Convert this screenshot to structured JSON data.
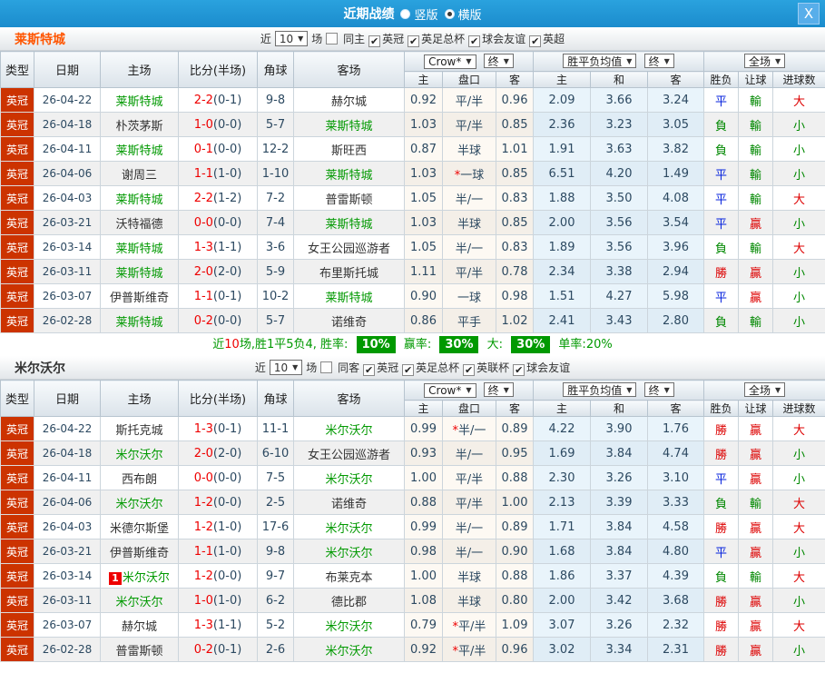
{
  "titlebar": {
    "title": "近期战绩",
    "vertical_label": "竖版",
    "horizontal_label": "横版",
    "selected_layout": "横版",
    "close_glyph": "X"
  },
  "colors": {
    "win": "#dd0000",
    "draw": "#0522dd",
    "lose": "#008800",
    "accent": "#cc3300",
    "bar": "#1e96d8",
    "badge": "#009900"
  },
  "columns": {
    "type": "类型",
    "date": "日期",
    "home": "主场",
    "score": "比分(半场)",
    "corner": "角球",
    "away": "客场",
    "sub": [
      "主",
      "盘口",
      "客",
      "主",
      "和",
      "客",
      "胜负",
      "让球",
      "进球数"
    ]
  },
  "dropdowns": {
    "crow": "Crow*",
    "final1": "终",
    "avg": "胜平负均值",
    "final2": "终",
    "full": "全场"
  },
  "sections": [
    {
      "team": "莱斯特城",
      "filter": {
        "near": "近",
        "count": "10",
        "games": "场",
        "same_label": "同主",
        "same_checked": false,
        "leagues": [
          {
            "label": "英冠",
            "checked": true
          },
          {
            "label": "英足总杯",
            "checked": true
          },
          {
            "label": "球会友谊",
            "checked": true
          },
          {
            "label": "英超",
            "checked": true
          }
        ]
      },
      "rows": [
        {
          "league": "英冠",
          "date": "26-04-22",
          "home": "莱斯特城",
          "home_self": true,
          "home_badge": "",
          "score": "2-2",
          "half": "(0-1)",
          "corners": "9-8",
          "away": "赫尔城",
          "away_self": false,
          "odds_home": "0.92",
          "handicap": "平/半",
          "handicap_star": false,
          "odds_away": "0.96",
          "avg_win": "2.09",
          "avg_draw": "3.66",
          "avg_lose": "3.24",
          "result_wdl": "平",
          "result_wdl_color": "draw",
          "result_handicap": "輸",
          "result_handicap_color": "lose",
          "result_goals": "大",
          "result_goals_color": "win"
        },
        {
          "league": "英冠",
          "date": "26-04-18",
          "home": "朴茨茅斯",
          "home_self": false,
          "home_badge": "",
          "score": "1-0",
          "half": "(0-0)",
          "corners": "5-7",
          "away": "莱斯特城",
          "away_self": true,
          "odds_home": "1.03",
          "handicap": "平/半",
          "handicap_star": false,
          "odds_away": "0.85",
          "avg_win": "2.36",
          "avg_draw": "3.23",
          "avg_lose": "3.05",
          "result_wdl": "負",
          "result_wdl_color": "lose",
          "result_handicap": "輸",
          "result_handicap_color": "lose",
          "result_goals": "小",
          "result_goals_color": "lose"
        },
        {
          "league": "英冠",
          "date": "26-04-11",
          "home": "莱斯特城",
          "home_self": true,
          "home_badge": "",
          "score": "0-1",
          "half": "(0-0)",
          "corners": "12-2",
          "away": "斯旺西",
          "away_self": false,
          "odds_home": "0.87",
          "handicap": "半球",
          "handicap_star": false,
          "odds_away": "1.01",
          "avg_win": "1.91",
          "avg_draw": "3.63",
          "avg_lose": "3.82",
          "result_wdl": "負",
          "result_wdl_color": "lose",
          "result_handicap": "輸",
          "result_handicap_color": "lose",
          "result_goals": "小",
          "result_goals_color": "lose"
        },
        {
          "league": "英冠",
          "date": "26-04-06",
          "home": "谢周三",
          "home_self": false,
          "home_badge": "",
          "score": "1-1",
          "half": "(1-0)",
          "corners": "1-10",
          "away": "莱斯特城",
          "away_self": true,
          "odds_home": "1.03",
          "handicap": "一球",
          "handicap_star": true,
          "odds_away": "0.85",
          "avg_win": "6.51",
          "avg_draw": "4.20",
          "avg_lose": "1.49",
          "result_wdl": "平",
          "result_wdl_color": "draw",
          "result_handicap": "輸",
          "result_handicap_color": "lose",
          "result_goals": "小",
          "result_goals_color": "lose"
        },
        {
          "league": "英冠",
          "date": "26-04-03",
          "home": "莱斯特城",
          "home_self": true,
          "home_badge": "",
          "score": "2-2",
          "half": "(1-2)",
          "corners": "7-2",
          "away": "普雷斯顿",
          "away_self": false,
          "odds_home": "1.05",
          "handicap": "半/一",
          "handicap_star": false,
          "odds_away": "0.83",
          "avg_win": "1.88",
          "avg_draw": "3.50",
          "avg_lose": "4.08",
          "result_wdl": "平",
          "result_wdl_color": "draw",
          "result_handicap": "輸",
          "result_handicap_color": "lose",
          "result_goals": "大",
          "result_goals_color": "win"
        },
        {
          "league": "英冠",
          "date": "26-03-21",
          "home": "沃特福德",
          "home_self": false,
          "home_badge": "",
          "score": "0-0",
          "half": "(0-0)",
          "corners": "7-4",
          "away": "莱斯特城",
          "away_self": true,
          "odds_home": "1.03",
          "handicap": "半球",
          "handicap_star": false,
          "odds_away": "0.85",
          "avg_win": "2.00",
          "avg_draw": "3.56",
          "avg_lose": "3.54",
          "result_wdl": "平",
          "result_wdl_color": "draw",
          "result_handicap": "贏",
          "result_handicap_color": "win",
          "result_goals": "小",
          "result_goals_color": "lose"
        },
        {
          "league": "英冠",
          "date": "26-03-14",
          "home": "莱斯特城",
          "home_self": true,
          "home_badge": "",
          "score": "1-3",
          "half": "(1-1)",
          "corners": "3-6",
          "away": "女王公园巡游者",
          "away_self": false,
          "odds_home": "1.05",
          "handicap": "半/一",
          "handicap_star": false,
          "odds_away": "0.83",
          "avg_win": "1.89",
          "avg_draw": "3.56",
          "avg_lose": "3.96",
          "result_wdl": "負",
          "result_wdl_color": "lose",
          "result_handicap": "輸",
          "result_handicap_color": "lose",
          "result_goals": "大",
          "result_goals_color": "win"
        },
        {
          "league": "英冠",
          "date": "26-03-11",
          "home": "莱斯特城",
          "home_self": true,
          "home_badge": "",
          "score": "2-0",
          "half": "(2-0)",
          "corners": "5-9",
          "away": "布里斯托城",
          "away_self": false,
          "odds_home": "1.11",
          "handicap": "平/半",
          "handicap_star": false,
          "odds_away": "0.78",
          "avg_win": "2.34",
          "avg_draw": "3.38",
          "avg_lose": "2.94",
          "result_wdl": "勝",
          "result_wdl_color": "win",
          "result_handicap": "贏",
          "result_handicap_color": "win",
          "result_goals": "小",
          "result_goals_color": "lose"
        },
        {
          "league": "英冠",
          "date": "26-03-07",
          "home": "伊普斯维奇",
          "home_self": false,
          "home_badge": "",
          "score": "1-1",
          "half": "(0-1)",
          "corners": "10-2",
          "away": "莱斯特城",
          "away_self": true,
          "odds_home": "0.90",
          "handicap": "一球",
          "handicap_star": false,
          "odds_away": "0.98",
          "avg_win": "1.51",
          "avg_draw": "4.27",
          "avg_lose": "5.98",
          "result_wdl": "平",
          "result_wdl_color": "draw",
          "result_handicap": "贏",
          "result_handicap_color": "win",
          "result_goals": "小",
          "result_goals_color": "lose"
        },
        {
          "league": "英冠",
          "date": "26-02-28",
          "home": "莱斯特城",
          "home_self": true,
          "home_badge": "",
          "score": "0-2",
          "half": "(0-0)",
          "corners": "5-7",
          "away": "诺维奇",
          "away_self": false,
          "odds_home": "0.86",
          "handicap": "平手",
          "handicap_star": false,
          "odds_away": "1.02",
          "avg_win": "2.41",
          "avg_draw": "3.43",
          "avg_lose": "2.80",
          "result_wdl": "負",
          "result_wdl_color": "lose",
          "result_handicap": "輸",
          "result_handicap_color": "lose",
          "result_goals": "小",
          "result_goals_color": "lose"
        }
      ],
      "summary": {
        "pre": "近",
        "count": "10",
        "mid": "场,胜1平5负4, 胜率:",
        "win_rate": "10%",
        "label2": "赢率:",
        "value2": "30%",
        "label3": "大:",
        "value3": "30%",
        "label4": "单率:",
        "value4": "20%"
      }
    },
    {
      "team": "米尔沃尔",
      "filter": {
        "near": "近",
        "count": "10",
        "games": "场",
        "same_label": "同客",
        "same_checked": false,
        "leagues": [
          {
            "label": "英冠",
            "checked": true
          },
          {
            "label": "英足总杯",
            "checked": true
          },
          {
            "label": "英联杯",
            "checked": true
          },
          {
            "label": "球会友谊",
            "checked": true
          }
        ]
      },
      "rows": [
        {
          "league": "英冠",
          "date": "26-04-22",
          "home": "斯托克城",
          "home_self": false,
          "home_badge": "",
          "score": "1-3",
          "half": "(0-1)",
          "corners": "11-1",
          "away": "米尔沃尔",
          "away_self": true,
          "odds_home": "0.99",
          "handicap": "半/一",
          "handicap_star": true,
          "odds_away": "0.89",
          "avg_win": "4.22",
          "avg_draw": "3.90",
          "avg_lose": "1.76",
          "result_wdl": "勝",
          "result_wdl_color": "win",
          "result_handicap": "贏",
          "result_handicap_color": "win",
          "result_goals": "大",
          "result_goals_color": "win"
        },
        {
          "league": "英冠",
          "date": "26-04-18",
          "home": "米尔沃尔",
          "home_self": true,
          "home_badge": "",
          "score": "2-0",
          "half": "(2-0)",
          "corners": "6-10",
          "away": "女王公园巡游者",
          "away_self": false,
          "odds_home": "0.93",
          "handicap": "半/一",
          "handicap_star": false,
          "odds_away": "0.95",
          "avg_win": "1.69",
          "avg_draw": "3.84",
          "avg_lose": "4.74",
          "result_wdl": "勝",
          "result_wdl_color": "win",
          "result_handicap": "贏",
          "result_handicap_color": "win",
          "result_goals": "小",
          "result_goals_color": "lose"
        },
        {
          "league": "英冠",
          "date": "26-04-11",
          "home": "西布朗",
          "home_self": false,
          "home_badge": "",
          "score": "0-0",
          "half": "(0-0)",
          "corners": "7-5",
          "away": "米尔沃尔",
          "away_self": true,
          "odds_home": "1.00",
          "handicap": "平/半",
          "handicap_star": false,
          "odds_away": "0.88",
          "avg_win": "2.30",
          "avg_draw": "3.26",
          "avg_lose": "3.10",
          "result_wdl": "平",
          "result_wdl_color": "draw",
          "result_handicap": "贏",
          "result_handicap_color": "win",
          "result_goals": "小",
          "result_goals_color": "lose"
        },
        {
          "league": "英冠",
          "date": "26-04-06",
          "home": "米尔沃尔",
          "home_self": true,
          "home_badge": "",
          "score": "1-2",
          "half": "(0-0)",
          "corners": "2-5",
          "away": "诺维奇",
          "away_self": false,
          "odds_home": "0.88",
          "handicap": "平/半",
          "handicap_star": false,
          "odds_away": "1.00",
          "avg_win": "2.13",
          "avg_draw": "3.39",
          "avg_lose": "3.33",
          "result_wdl": "負",
          "result_wdl_color": "lose",
          "result_handicap": "輸",
          "result_handicap_color": "lose",
          "result_goals": "大",
          "result_goals_color": "win"
        },
        {
          "league": "英冠",
          "date": "26-04-03",
          "home": "米德尔斯堡",
          "home_self": false,
          "home_badge": "",
          "score": "1-2",
          "half": "(1-0)",
          "corners": "17-6",
          "away": "米尔沃尔",
          "away_self": true,
          "odds_home": "0.99",
          "handicap": "半/一",
          "handicap_star": false,
          "odds_away": "0.89",
          "avg_win": "1.71",
          "avg_draw": "3.84",
          "avg_lose": "4.58",
          "result_wdl": "勝",
          "result_wdl_color": "win",
          "result_handicap": "贏",
          "result_handicap_color": "win",
          "result_goals": "大",
          "result_goals_color": "win"
        },
        {
          "league": "英冠",
          "date": "26-03-21",
          "home": "伊普斯维奇",
          "home_self": false,
          "home_badge": "",
          "score": "1-1",
          "half": "(1-0)",
          "corners": "9-8",
          "away": "米尔沃尔",
          "away_self": true,
          "odds_home": "0.98",
          "handicap": "半/一",
          "handicap_star": false,
          "odds_away": "0.90",
          "avg_win": "1.68",
          "avg_draw": "3.84",
          "avg_lose": "4.80",
          "result_wdl": "平",
          "result_wdl_color": "draw",
          "result_handicap": "贏",
          "result_handicap_color": "win",
          "result_goals": "小",
          "result_goals_color": "lose"
        },
        {
          "league": "英冠",
          "date": "26-03-14",
          "home": "米尔沃尔",
          "home_self": true,
          "home_badge": "1",
          "score": "1-2",
          "half": "(0-0)",
          "corners": "9-7",
          "away": "布莱克本",
          "away_self": false,
          "odds_home": "1.00",
          "handicap": "半球",
          "handicap_star": false,
          "odds_away": "0.88",
          "avg_win": "1.86",
          "avg_draw": "3.37",
          "avg_lose": "4.39",
          "result_wdl": "負",
          "result_wdl_color": "lose",
          "result_handicap": "輸",
          "result_handicap_color": "lose",
          "result_goals": "大",
          "result_goals_color": "win"
        },
        {
          "league": "英冠",
          "date": "26-03-11",
          "home": "米尔沃尔",
          "home_self": true,
          "home_badge": "",
          "score": "1-0",
          "half": "(1-0)",
          "corners": "6-2",
          "away": "德比郡",
          "away_self": false,
          "odds_home": "1.08",
          "handicap": "半球",
          "handicap_star": false,
          "odds_away": "0.80",
          "avg_win": "2.00",
          "avg_draw": "3.42",
          "avg_lose": "3.68",
          "result_wdl": "勝",
          "result_wdl_color": "win",
          "result_handicap": "贏",
          "result_handicap_color": "win",
          "result_goals": "小",
          "result_goals_color": "lose"
        },
        {
          "league": "英冠",
          "date": "26-03-07",
          "home": "赫尔城",
          "home_self": false,
          "home_badge": "",
          "score": "1-3",
          "half": "(1-1)",
          "corners": "5-2",
          "away": "米尔沃尔",
          "away_self": true,
          "odds_home": "0.79",
          "handicap": "平/半",
          "handicap_star": true,
          "odds_away": "1.09",
          "avg_win": "3.07",
          "avg_draw": "3.26",
          "avg_lose": "2.32",
          "result_wdl": "勝",
          "result_wdl_color": "win",
          "result_handicap": "贏",
          "result_handicap_color": "win",
          "result_goals": "大",
          "result_goals_color": "win"
        },
        {
          "league": "英冠",
          "date": "26-02-28",
          "home": "普雷斯顿",
          "home_self": false,
          "home_badge": "",
          "score": "0-2",
          "half": "(0-1)",
          "corners": "2-6",
          "away": "米尔沃尔",
          "away_self": true,
          "odds_home": "0.92",
          "handicap": "平/半",
          "handicap_star": true,
          "odds_away": "0.96",
          "avg_win": "3.02",
          "avg_draw": "3.34",
          "avg_lose": "2.31",
          "result_wdl": "勝",
          "result_wdl_color": "win",
          "result_handicap": "贏",
          "result_handicap_color": "win",
          "result_goals": "小",
          "result_goals_color": "lose"
        }
      ],
      "summary": null
    }
  ]
}
